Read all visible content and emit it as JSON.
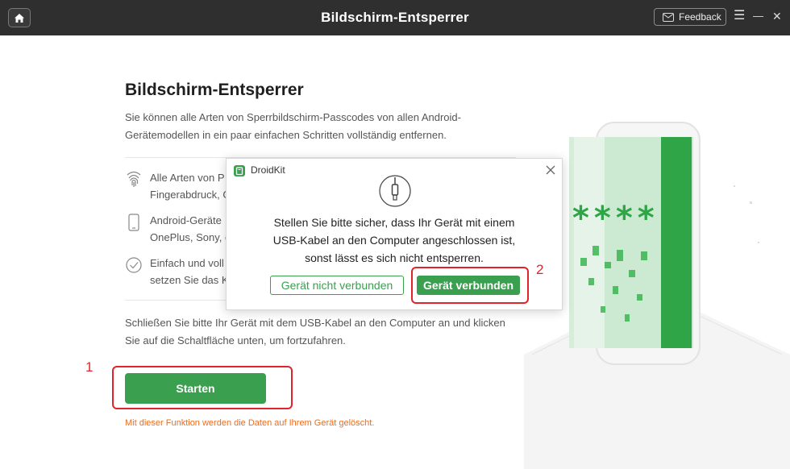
{
  "app": {
    "title": "Bildschirm-Entsperrer",
    "feedback_label": "Feedback",
    "menu_glyph": "☰",
    "minimize_glyph": "—",
    "close_glyph": "✕"
  },
  "main": {
    "title": "Bildschirm-Entsperrer",
    "description_line1": "Sie können alle Arten von Sperrbildschirm-Passcodes von allen Android-",
    "description_line2": "Gerätemodellen in ein paar einfachen Schritten vollständig entfernen.",
    "features": [
      {
        "icon": "fingerprint-icon",
        "line1": "Alle Arten von P",
        "line2": "Fingerabdruck, G"
      },
      {
        "icon": "phone-icon",
        "line1": "Android-Geräte",
        "line2": "OnePlus, Sony, e"
      },
      {
        "icon": "check-circle-icon",
        "line1": "Einfach und voll",
        "line2": "setzen Sie das K"
      }
    ],
    "instruction_line1": "Schließen Sie bitte Ihr Gerät mit dem USB-Kabel an den Computer an und klicken",
    "instruction_line2": "Sie auf die Schaltfläche unten, um fortzufahren.",
    "start_label": "Starten",
    "warning": "Mit dieser Funktion werden die Daten auf Ihrem Gerät gelöscht."
  },
  "annotations": {
    "step1": "1",
    "step2": "2"
  },
  "dialog": {
    "title": "DroidKit",
    "message_line1": "Stellen Sie bitte sicher, dass Ihr Gerät mit einem",
    "message_line2": "USB-Kabel an den Computer angeschlossen ist,",
    "message_line3": "sonst lässt es sich nicht entsperren.",
    "btn_not_connected": "Gerät nicht verbunden",
    "btn_connected": "Gerät verbunden"
  },
  "illustration": {
    "password_mask": "****"
  },
  "colors": {
    "accent": "#3aa050",
    "titlebar": "#2f2f2f",
    "warning": "#ef6b1a",
    "annotation": "#e0242a"
  }
}
